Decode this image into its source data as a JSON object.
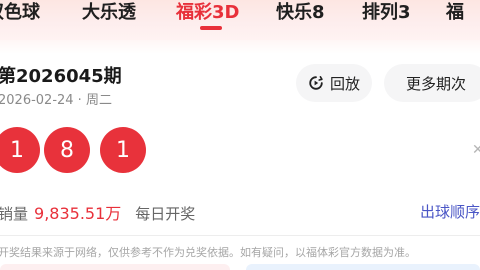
{
  "tabs": [
    {
      "label": "双色球",
      "active": false
    },
    {
      "label": "大乐透",
      "active": false
    },
    {
      "label": "福彩3D",
      "active": true
    },
    {
      "label": "快乐8",
      "active": false
    },
    {
      "label": "排列3",
      "active": false
    },
    {
      "label": "福",
      "active": false
    }
  ],
  "colors": {
    "accent": "#e8303a",
    "ball": "#e8323b",
    "link": "#4a56c6"
  },
  "draw": {
    "issue": "第2026045期",
    "date": "2026-02-24 · 周二",
    "replay_label": "回放",
    "more_label": "更多期次",
    "balls": [
      "1",
      "8",
      "1"
    ],
    "collapse_icon": "close-icon"
  },
  "sales": {
    "label": "销量",
    "amount": "9,835.51万",
    "frequency": "每日开奖",
    "order_link": "出球顺序"
  },
  "disclaimer": "开奖结果来源于网络，仅供参考不作为兑奖依据。如有疑问，以福体彩官方数据为准。"
}
